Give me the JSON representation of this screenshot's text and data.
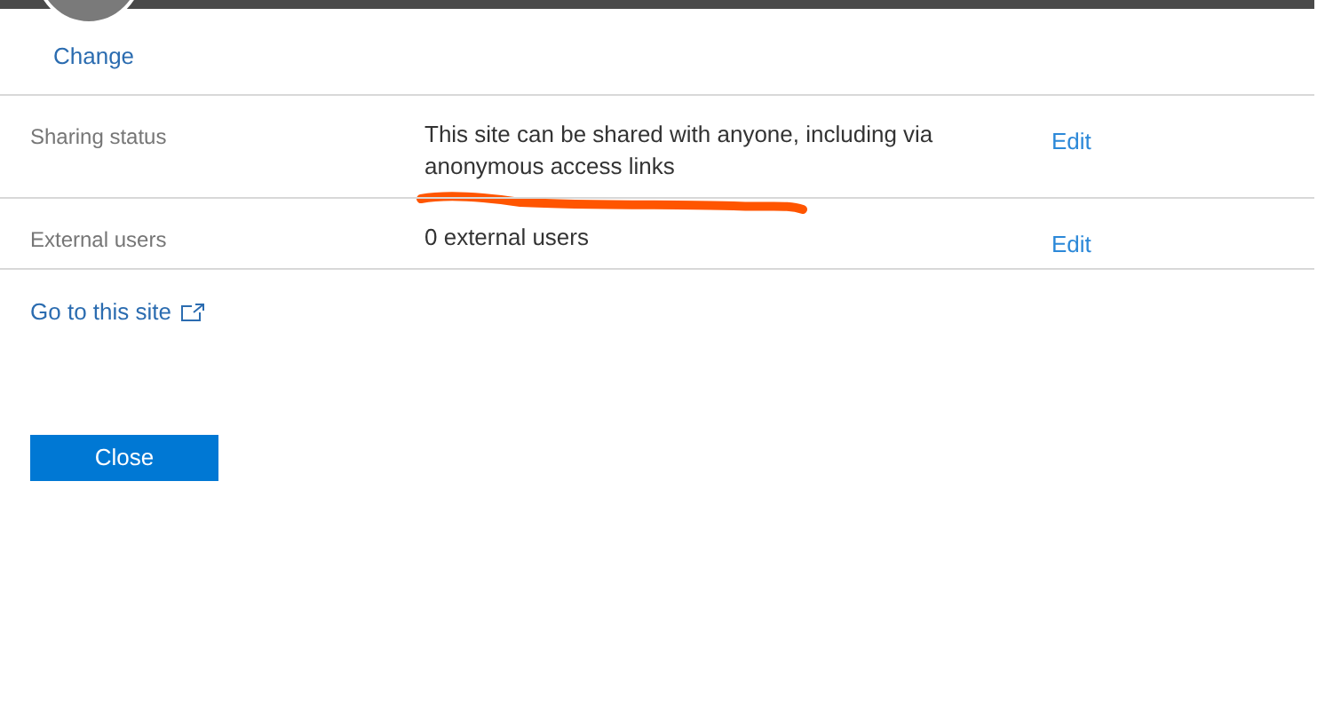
{
  "avatar": {
    "action": "Change"
  },
  "rows": [
    {
      "label": "Sharing status",
      "value": "This site can be shared with anyone, including via anonymous access links",
      "action": "Edit",
      "annotated": true
    },
    {
      "label": "External users",
      "value": "0 external users",
      "action": "Edit",
      "annotated": false
    }
  ],
  "site_link": "Go to this site",
  "close_button": "Close"
}
